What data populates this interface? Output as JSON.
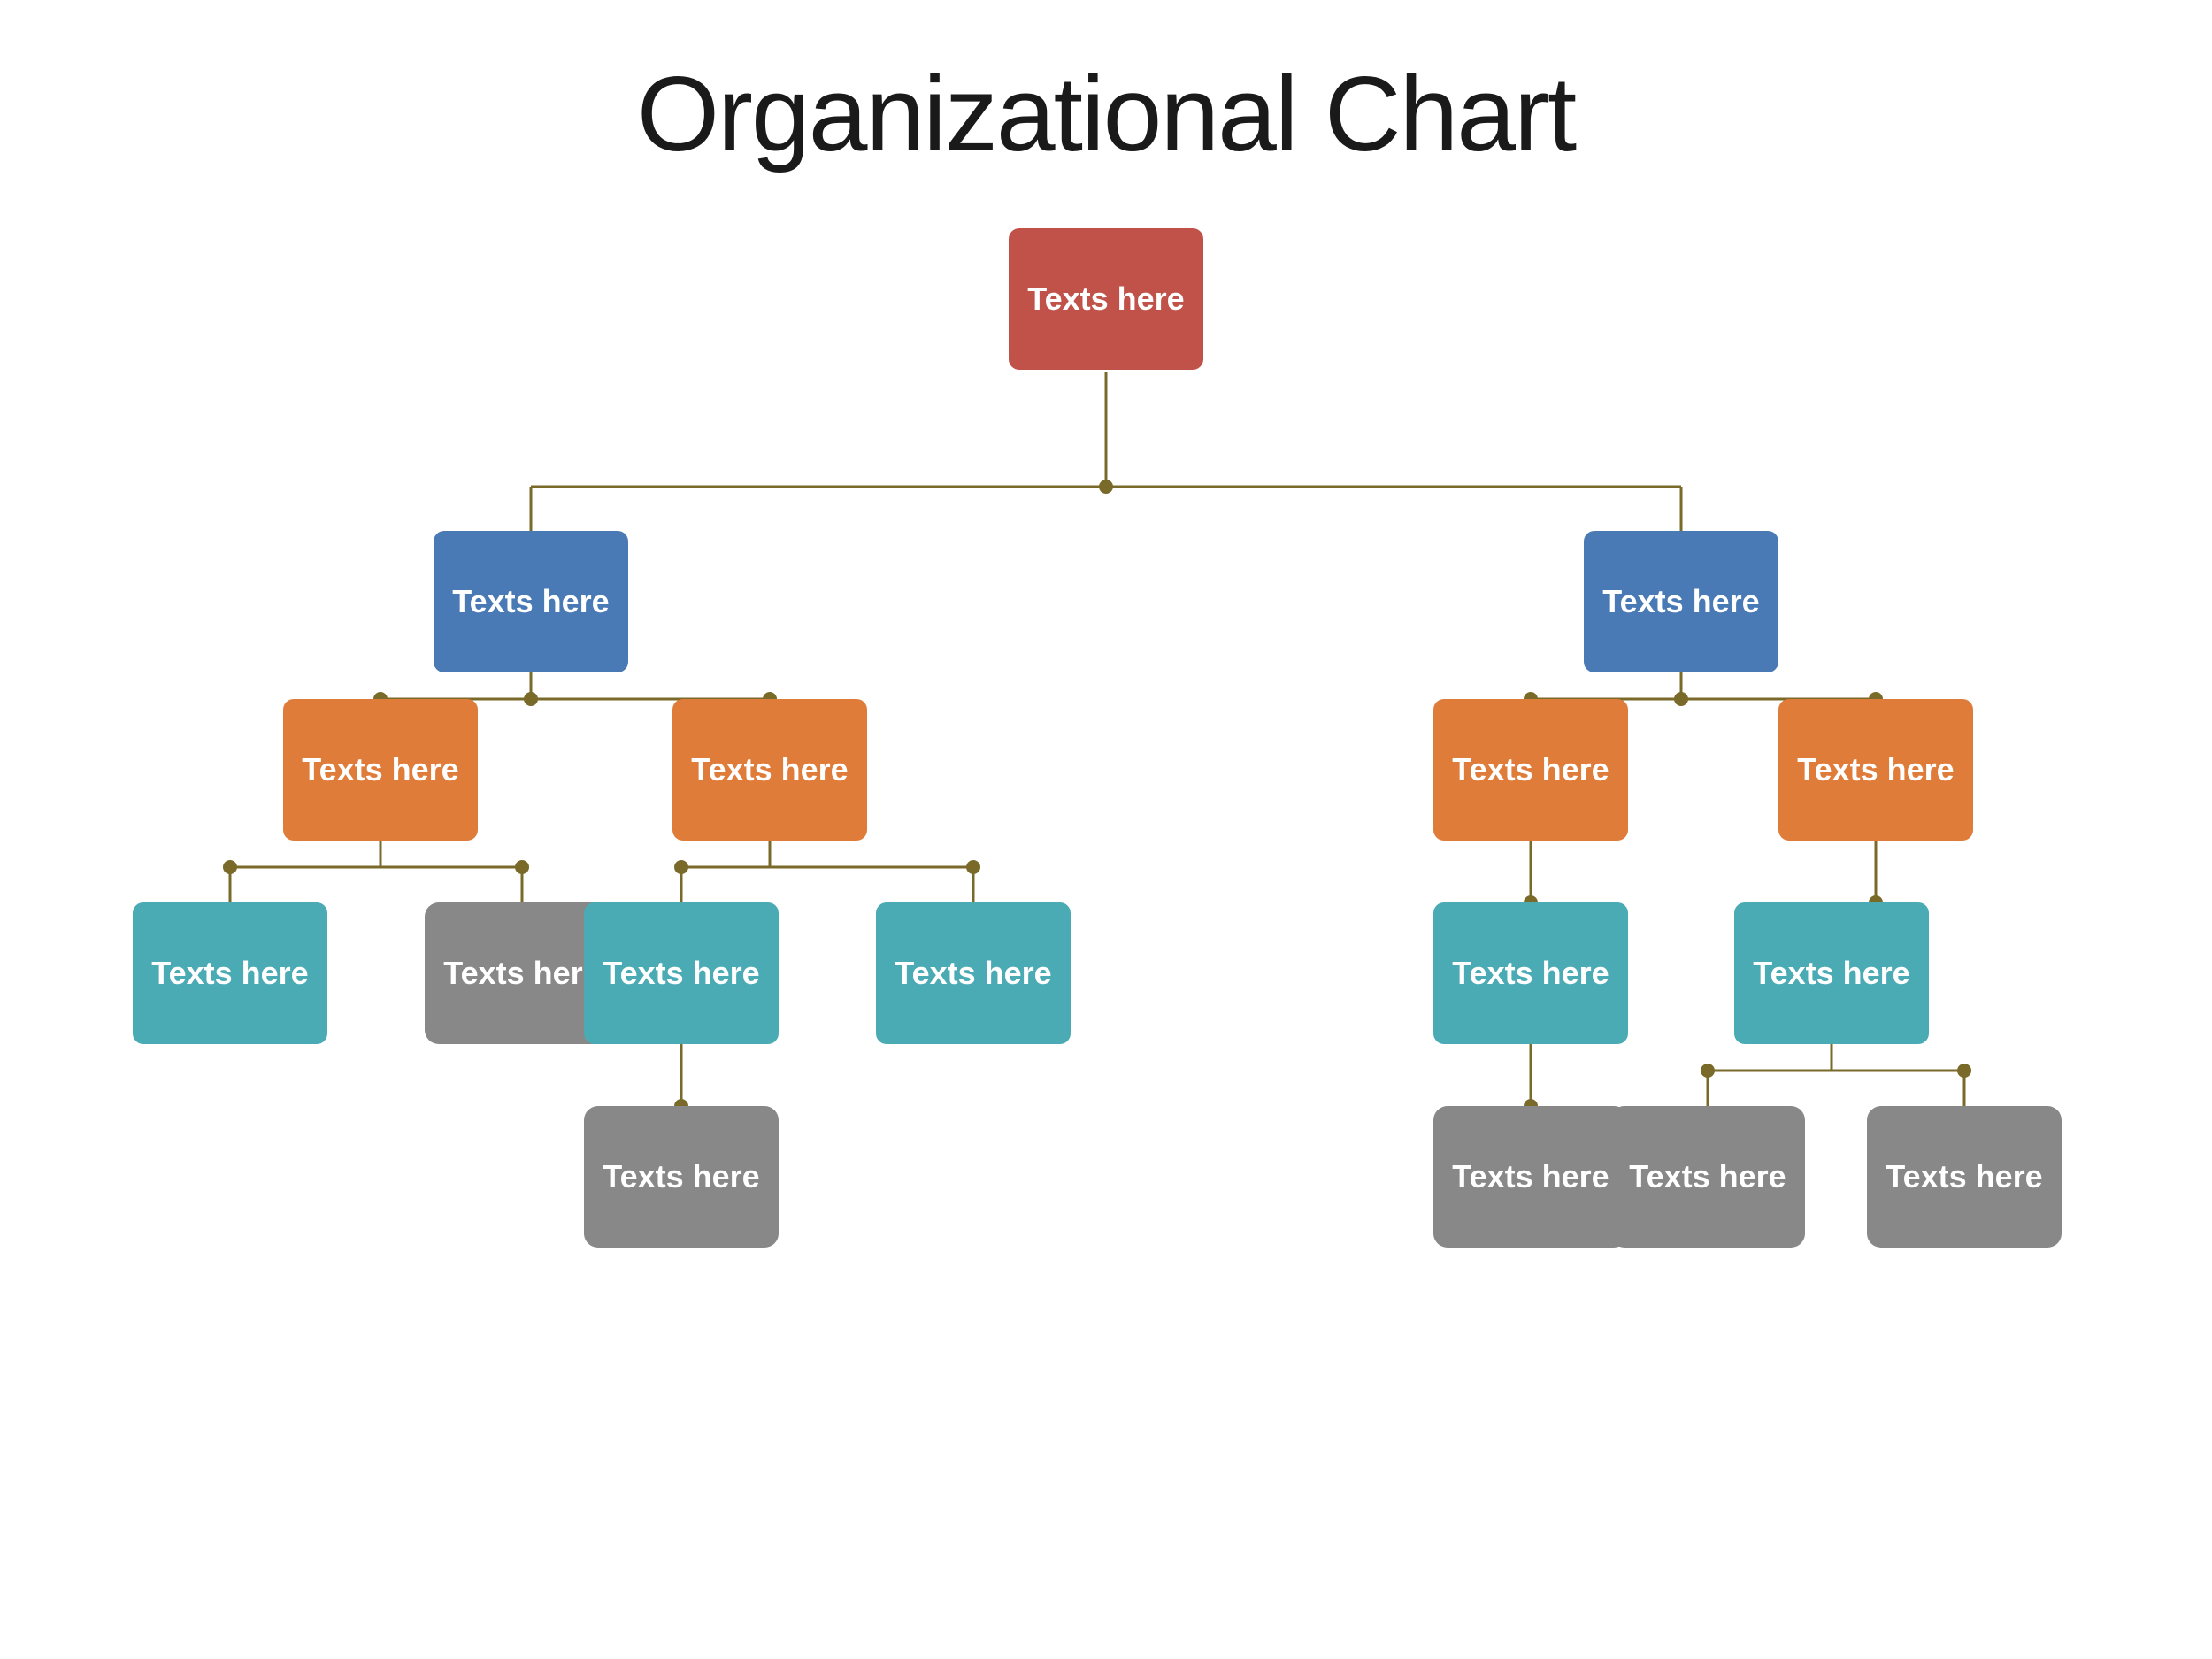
{
  "title": "Organizational Chart",
  "colors": {
    "line": "#7a6a2a",
    "dot": "#7a6a2a",
    "red": "#c0524a",
    "blue": "#4a7ab5",
    "orange": "#e07c3a",
    "teal": "#4aabb5",
    "gray": "#888888"
  },
  "nodes": {
    "root": {
      "label": "Texts\nhere",
      "color": "red"
    },
    "l1_left": {
      "label": "Texts\nhere",
      "color": "blue"
    },
    "l1_right": {
      "label": "Texts\nhere",
      "color": "blue"
    },
    "l2_a": {
      "label": "Texts\nhere",
      "color": "orange"
    },
    "l2_b": {
      "label": "Texts\nhere",
      "color": "orange"
    },
    "l2_c": {
      "label": "Texts\nhere",
      "color": "orange"
    },
    "l2_d": {
      "label": "Texts\nhere",
      "color": "orange"
    },
    "l3_a1": {
      "label": "Texts\nhere",
      "color": "teal"
    },
    "l3_a2": {
      "label": "Texts\nhere",
      "color": "gray"
    },
    "l3_b1": {
      "label": "Texts\nhere",
      "color": "teal"
    },
    "l3_b2": {
      "label": "Texts\nhere",
      "color": "teal"
    },
    "l3_c1": {
      "label": "Texts\nhere",
      "color": "teal"
    },
    "l3_d1": {
      "label": "Texts\nhere",
      "color": "teal"
    },
    "l4_b1": {
      "label": "Texts\nhere",
      "color": "gray"
    },
    "l4_c1": {
      "label": "Texts\nhere",
      "color": "gray"
    },
    "l4_d1a": {
      "label": "Texts\nhere",
      "color": "gray"
    },
    "l4_d1b": {
      "label": "Texts\nhere",
      "color": "gray"
    }
  }
}
